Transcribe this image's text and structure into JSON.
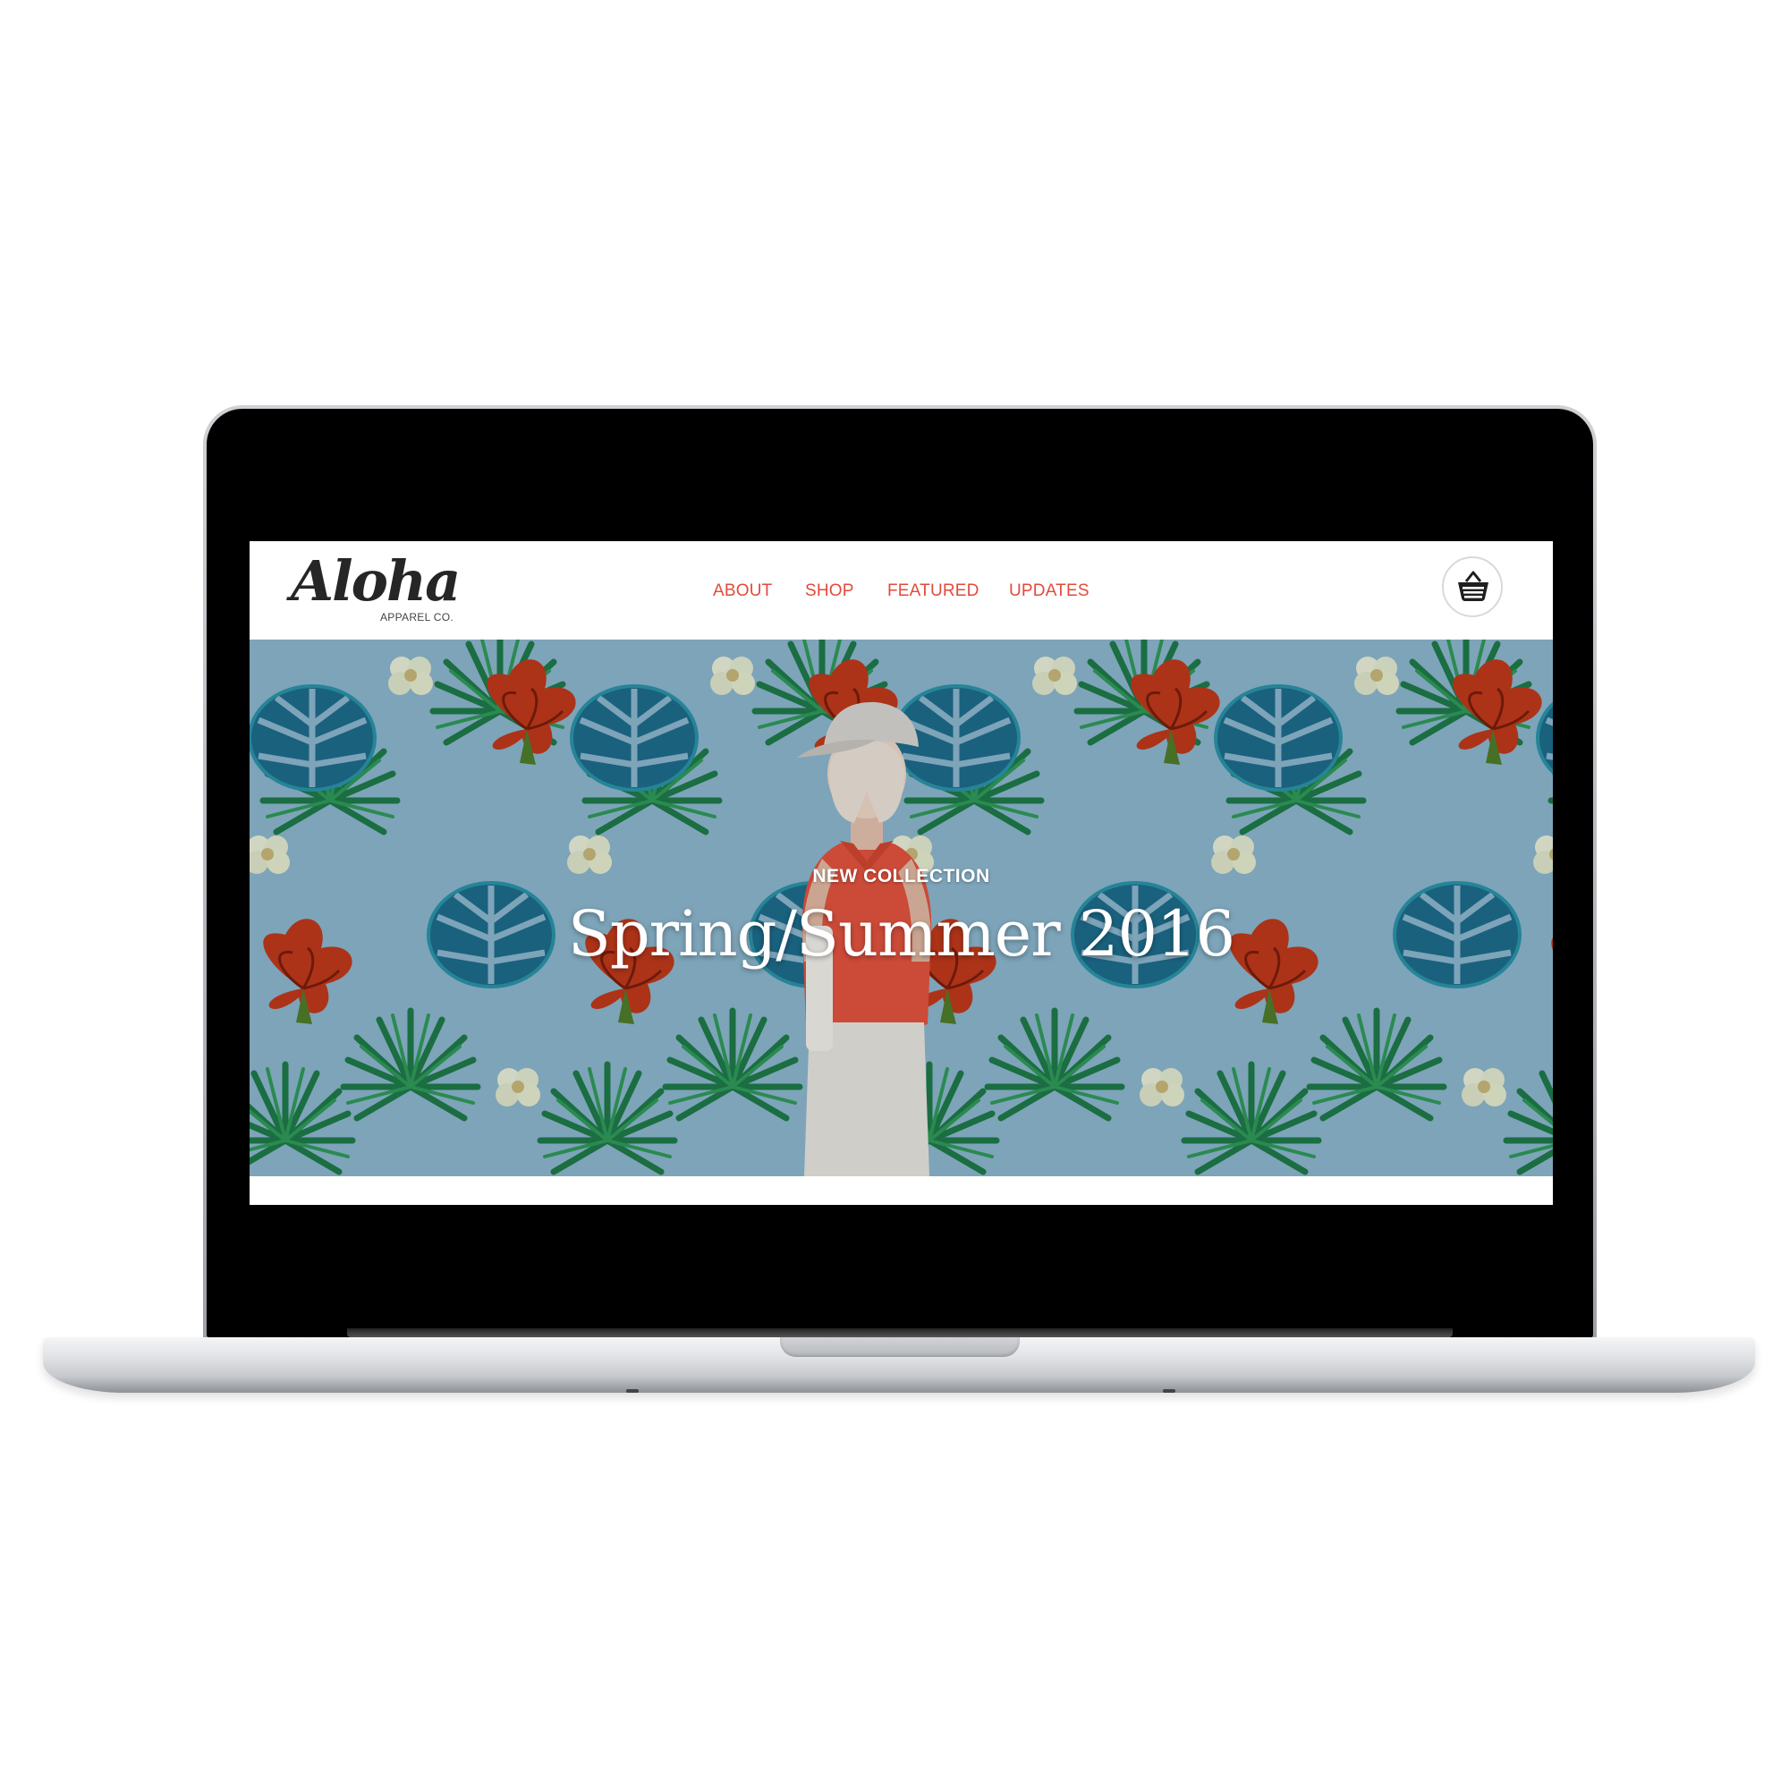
{
  "logo": {
    "script": "Aloha",
    "subtitle": "APPAREL CO."
  },
  "nav": {
    "items": [
      {
        "label": "ABOUT"
      },
      {
        "label": "SHOP"
      },
      {
        "label": "FEATURED"
      },
      {
        "label": "UPDATES"
      }
    ]
  },
  "cart": {
    "icon": "basket-icon"
  },
  "hero": {
    "eyebrow": "NEW COLLECTION",
    "headline": "Spring/Summer 2016"
  },
  "colors": {
    "accent": "#e24a3c",
    "hero_background": "#8cb7cf",
    "logo": "#262626",
    "shirt": "#e4533f"
  }
}
